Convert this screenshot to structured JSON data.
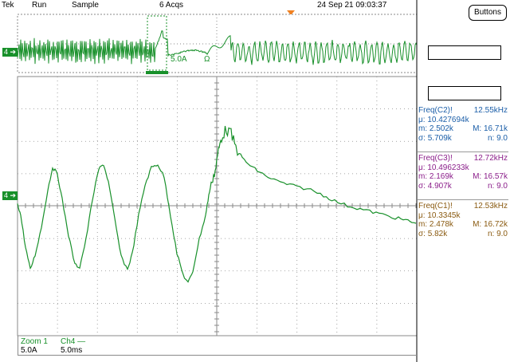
{
  "status_bar": {
    "brand": "Tek",
    "run_state": "Run",
    "acq_mode": "Sample",
    "acq_count": "6 Acqs",
    "date_time": "24 Sep 21 09:03:37"
  },
  "buttons_label": "Buttons",
  "channel_marker": "4",
  "overview_labels": {
    "ref_a": "5.0A",
    "ohm": "Ω"
  },
  "measurements": [
    {
      "title": "Freq(C2)!",
      "value": "12.55kHz",
      "mean": "μ: 10.427694k",
      "min": "m: 2.502k",
      "max": "M: 16.71k",
      "sigma": "σ: 5.709k",
      "n": "n: 9.0",
      "color": "#1b5ea8"
    },
    {
      "title": "Freq(C3)!",
      "value": "12.72kHz",
      "mean": "μ: 10.496233k",
      "min": "m: 2.169k",
      "max": "M: 16.57k",
      "sigma": "σ: 4.907k",
      "n": "n: 9.0",
      "color": "#8b1e8a"
    },
    {
      "title": "Freq(C1)!",
      "value": "12.53kHz",
      "mean": "μ: 10.3345k",
      "min": "m: 2.478k",
      "max": "M: 16.72k",
      "sigma": "σ: 5.82k",
      "n": "n: 9.0",
      "color": "#8a5a10"
    }
  ],
  "bottom_info": {
    "zoom": "Zoom 1",
    "channel": "Ch4 —",
    "vscale": "5.0A",
    "hscale": "5.0ms"
  },
  "colors": {
    "trace": "#18902a",
    "graticule": "#8a8a8a",
    "trigger": "#f08020"
  }
}
